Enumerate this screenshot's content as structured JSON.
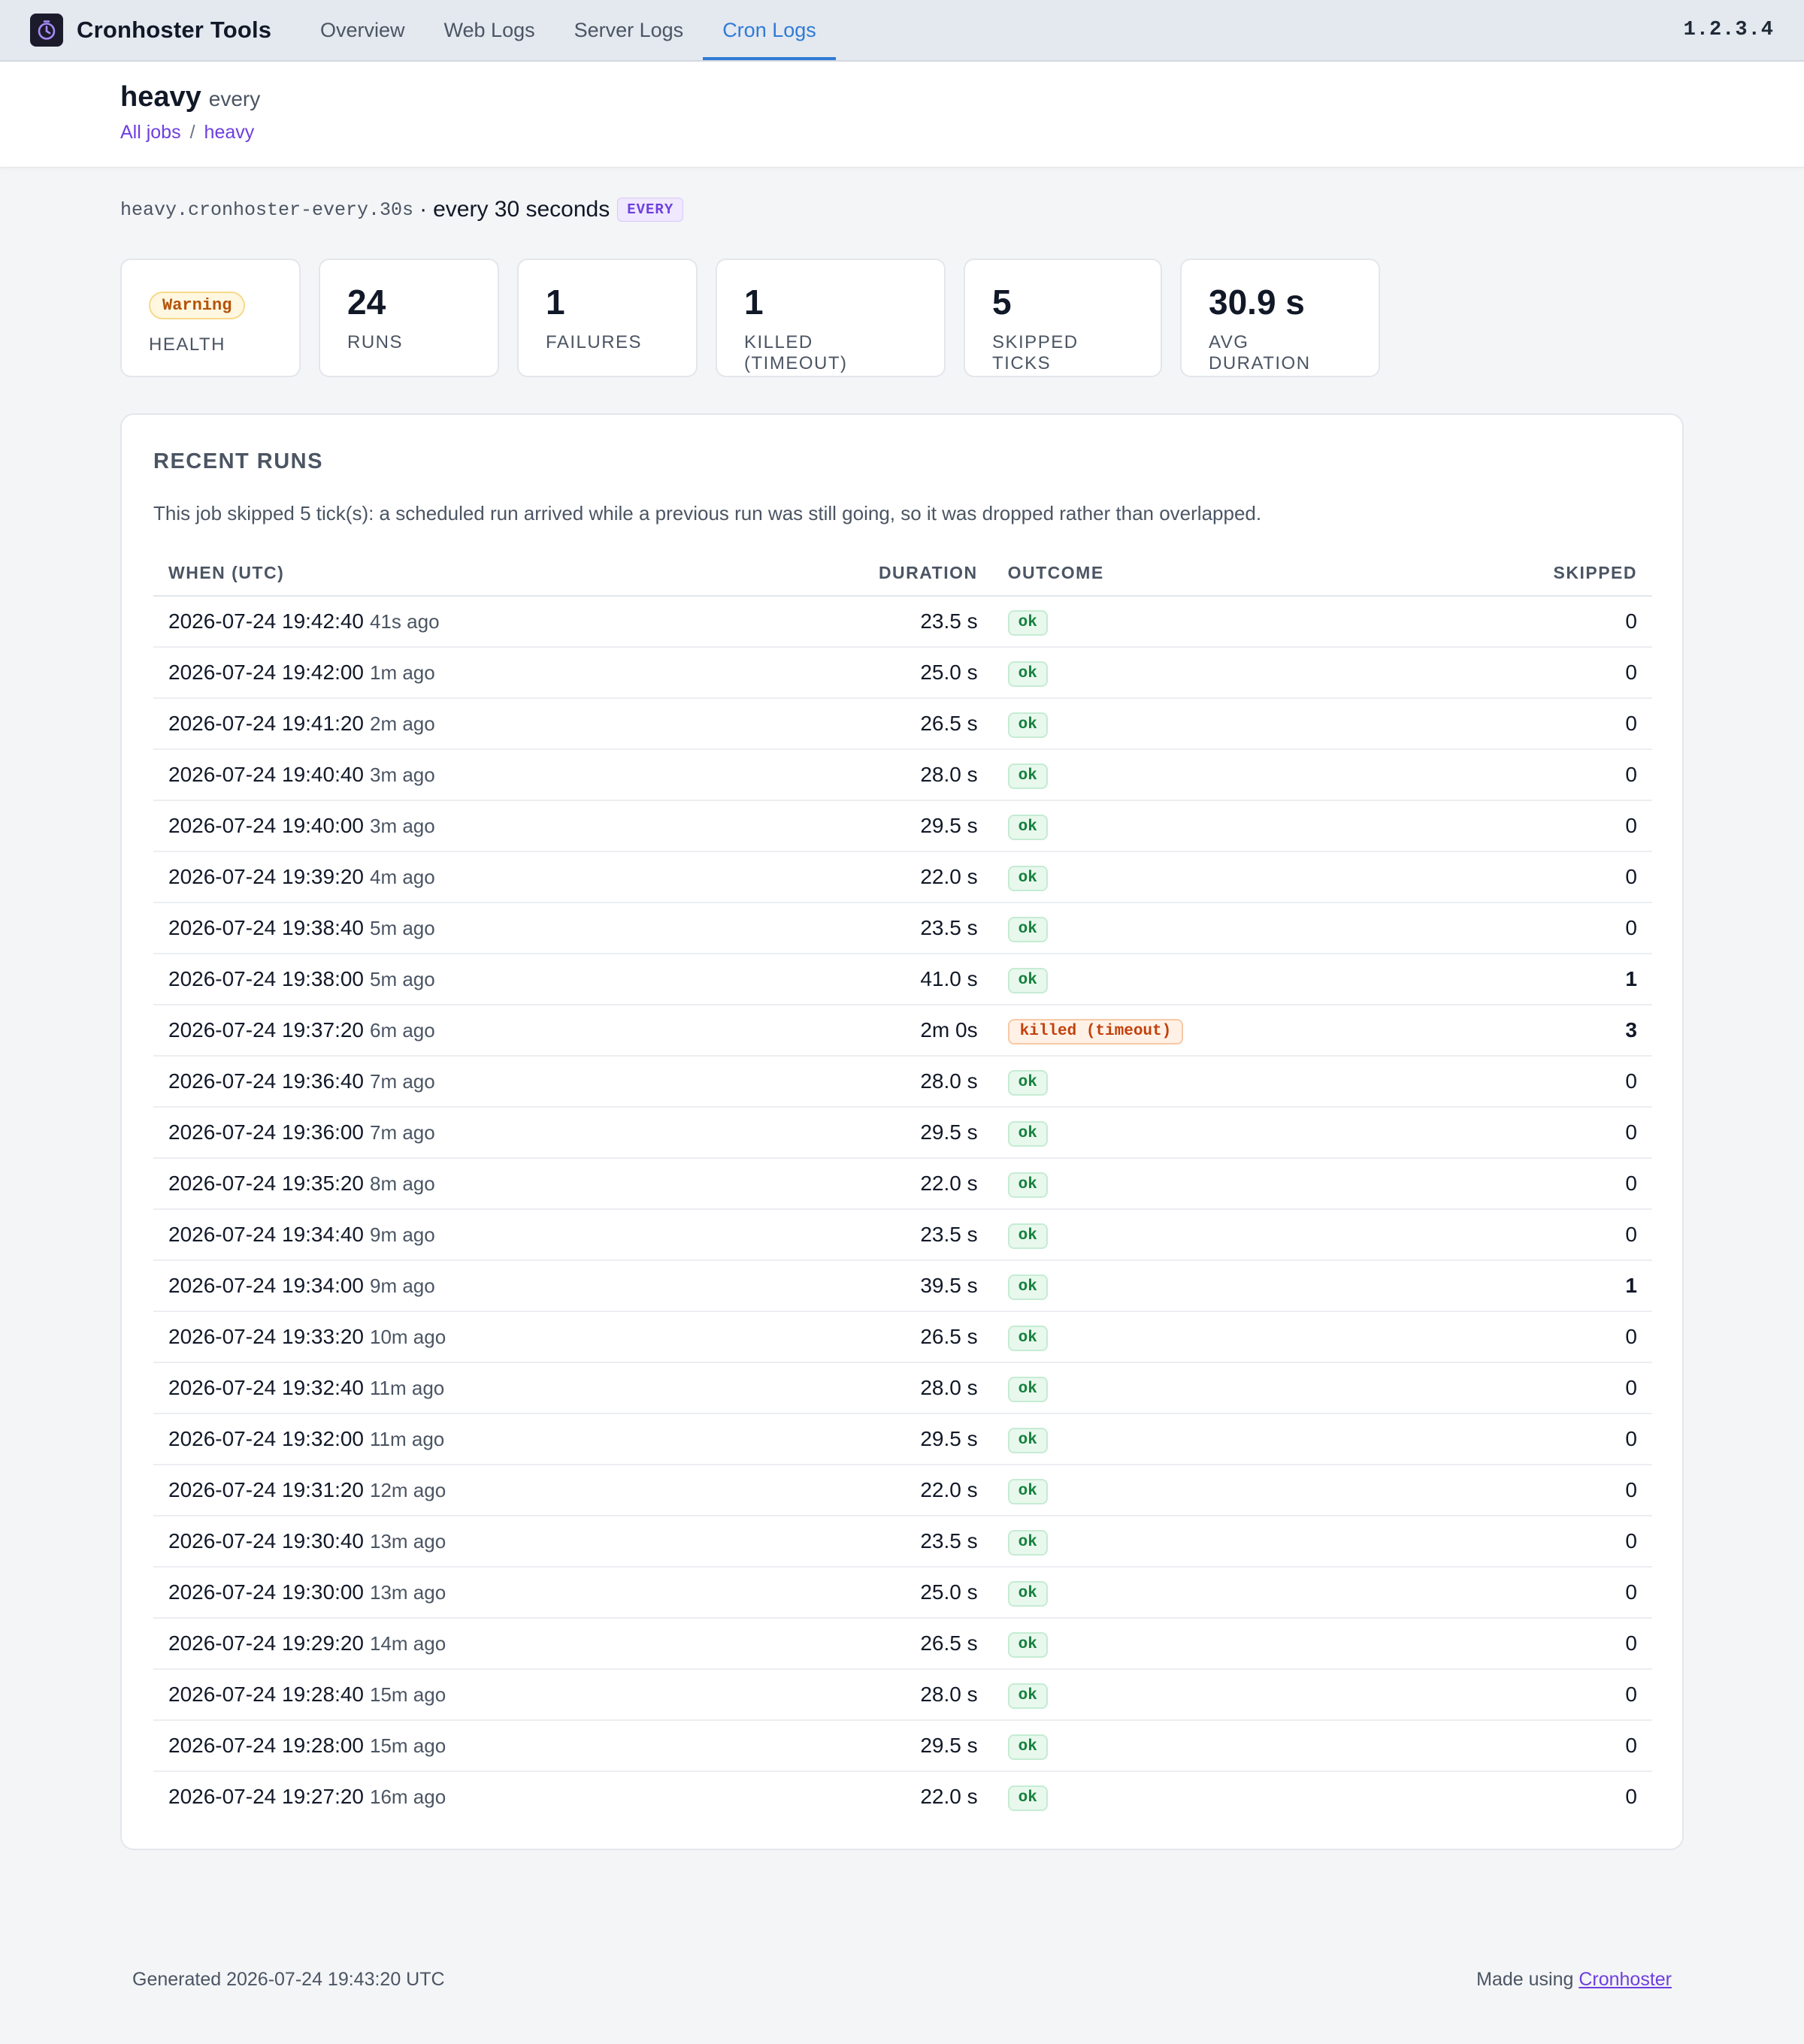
{
  "nav": {
    "brand": "Cronhoster Tools",
    "tabs": [
      "Overview",
      "Web Logs",
      "Server Logs",
      "Cron Logs"
    ],
    "active_tab": "Cron Logs",
    "version": "1.2.3.4"
  },
  "header": {
    "title": "heavy",
    "kind": "every",
    "breadcrumb": {
      "root": "All jobs",
      "sep": "/",
      "current": "heavy"
    }
  },
  "schedule": {
    "id": "heavy.cronhoster-every.30s",
    "dot": "·",
    "description": "every 30 seconds",
    "badge": "EVERY"
  },
  "stats": {
    "health": {
      "badge": "Warning",
      "label": "HEALTH"
    },
    "runs": {
      "value": "24",
      "label": "RUNS"
    },
    "failures": {
      "value": "1",
      "label": "FAILURES"
    },
    "killed": {
      "value": "1",
      "label": "KILLED (TIMEOUT)"
    },
    "skipped": {
      "value": "5",
      "label": "SKIPPED TICKS"
    },
    "avg": {
      "value": "30.9 s",
      "label": "AVG DURATION"
    }
  },
  "runs_panel": {
    "title": "RECENT RUNS",
    "note": "This job skipped 5 tick(s): a scheduled run arrived while a previous run was still going, so it was dropped rather than overlapped.",
    "columns": {
      "when": "WHEN (UTC)",
      "duration": "DURATION",
      "outcome": "OUTCOME",
      "skipped": "SKIPPED"
    },
    "rows": [
      {
        "when": "2026-07-24 19:42:40",
        "ago": "41s ago",
        "duration": "23.5 s",
        "outcome": "ok",
        "skipped": "0"
      },
      {
        "when": "2026-07-24 19:42:00",
        "ago": "1m ago",
        "duration": "25.0 s",
        "outcome": "ok",
        "skipped": "0"
      },
      {
        "when": "2026-07-24 19:41:20",
        "ago": "2m ago",
        "duration": "26.5 s",
        "outcome": "ok",
        "skipped": "0"
      },
      {
        "when": "2026-07-24 19:40:40",
        "ago": "3m ago",
        "duration": "28.0 s",
        "outcome": "ok",
        "skipped": "0"
      },
      {
        "when": "2026-07-24 19:40:00",
        "ago": "3m ago",
        "duration": "29.5 s",
        "outcome": "ok",
        "skipped": "0"
      },
      {
        "when": "2026-07-24 19:39:20",
        "ago": "4m ago",
        "duration": "22.0 s",
        "outcome": "ok",
        "skipped": "0"
      },
      {
        "when": "2026-07-24 19:38:40",
        "ago": "5m ago",
        "duration": "23.5 s",
        "outcome": "ok",
        "skipped": "0"
      },
      {
        "when": "2026-07-24 19:38:00",
        "ago": "5m ago",
        "duration": "41.0 s",
        "outcome": "ok",
        "skipped": "1"
      },
      {
        "when": "2026-07-24 19:37:20",
        "ago": "6m ago",
        "duration": "2m 0s",
        "outcome": "killed (timeout)",
        "skipped": "3"
      },
      {
        "when": "2026-07-24 19:36:40",
        "ago": "7m ago",
        "duration": "28.0 s",
        "outcome": "ok",
        "skipped": "0"
      },
      {
        "when": "2026-07-24 19:36:00",
        "ago": "7m ago",
        "duration": "29.5 s",
        "outcome": "ok",
        "skipped": "0"
      },
      {
        "when": "2026-07-24 19:35:20",
        "ago": "8m ago",
        "duration": "22.0 s",
        "outcome": "ok",
        "skipped": "0"
      },
      {
        "when": "2026-07-24 19:34:40",
        "ago": "9m ago",
        "duration": "23.5 s",
        "outcome": "ok",
        "skipped": "0"
      },
      {
        "when": "2026-07-24 19:34:00",
        "ago": "9m ago",
        "duration": "39.5 s",
        "outcome": "ok",
        "skipped": "1"
      },
      {
        "when": "2026-07-24 19:33:20",
        "ago": "10m ago",
        "duration": "26.5 s",
        "outcome": "ok",
        "skipped": "0"
      },
      {
        "when": "2026-07-24 19:32:40",
        "ago": "11m ago",
        "duration": "28.0 s",
        "outcome": "ok",
        "skipped": "0"
      },
      {
        "when": "2026-07-24 19:32:00",
        "ago": "11m ago",
        "duration": "29.5 s",
        "outcome": "ok",
        "skipped": "0"
      },
      {
        "when": "2026-07-24 19:31:20",
        "ago": "12m ago",
        "duration": "22.0 s",
        "outcome": "ok",
        "skipped": "0"
      },
      {
        "when": "2026-07-24 19:30:40",
        "ago": "13m ago",
        "duration": "23.5 s",
        "outcome": "ok",
        "skipped": "0"
      },
      {
        "when": "2026-07-24 19:30:00",
        "ago": "13m ago",
        "duration": "25.0 s",
        "outcome": "ok",
        "skipped": "0"
      },
      {
        "when": "2026-07-24 19:29:20",
        "ago": "14m ago",
        "duration": "26.5 s",
        "outcome": "ok",
        "skipped": "0"
      },
      {
        "when": "2026-07-24 19:28:40",
        "ago": "15m ago",
        "duration": "28.0 s",
        "outcome": "ok",
        "skipped": "0"
      },
      {
        "when": "2026-07-24 19:28:00",
        "ago": "15m ago",
        "duration": "29.5 s",
        "outcome": "ok",
        "skipped": "0"
      },
      {
        "when": "2026-07-24 19:27:20",
        "ago": "16m ago",
        "duration": "22.0 s",
        "outcome": "ok",
        "skipped": "0"
      }
    ]
  },
  "footer": {
    "generated": "Generated 2026-07-24 19:43:20 UTC",
    "made_using": "Made using",
    "link": "Cronhoster"
  },
  "colors": {
    "accent": "#2f7bd6",
    "link": "#6d3fe0",
    "ok": "#15803d",
    "warn": "#c2410c",
    "warning_badge": "#b45309"
  },
  "icons": {
    "brand": "stopwatch-icon"
  }
}
